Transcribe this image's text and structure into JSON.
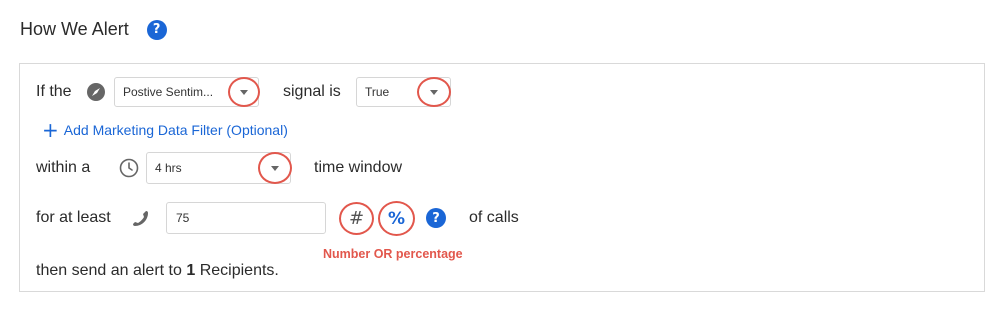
{
  "header": {
    "title": "How We Alert",
    "help_glyph": "?"
  },
  "rule": {
    "signal_prefix": "If the",
    "signal_select": {
      "value": "Postive Sentim...",
      "icon": "compass-icon"
    },
    "signal_suffix": "signal is",
    "value_select": {
      "value": "True"
    },
    "add_filter_link": "Add Marketing Data Filter (Optional)",
    "window_prefix": "within a",
    "window_select": {
      "value": "4 hrs",
      "icon": "clock-icon"
    },
    "window_suffix": "time window",
    "threshold_prefix": "for at least",
    "threshold_input": {
      "value": "75",
      "icon": "phone-icon"
    },
    "number_toggle": "#",
    "percent_toggle": "%",
    "threshold_suffix": "of calls",
    "annotation": "Number OR percentage",
    "send_prefix": "then send an alert to",
    "recipient_count": "1",
    "send_suffix": "Recipients."
  },
  "colors": {
    "accent": "#1a66d6",
    "annotation": "#e2574c"
  }
}
